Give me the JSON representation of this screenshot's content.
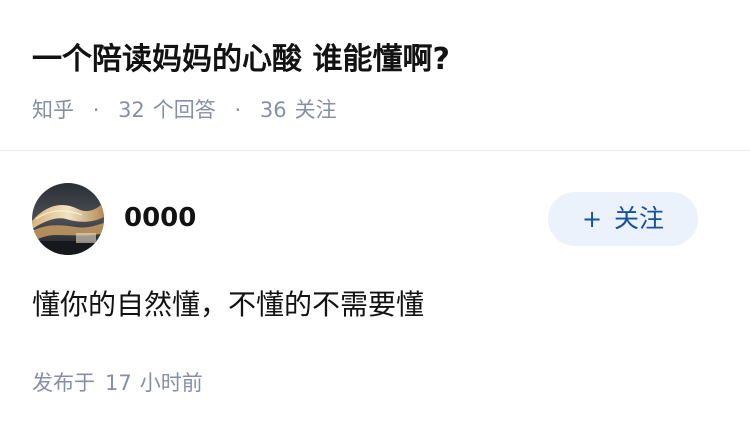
{
  "question": {
    "title": "一个陪读妈妈的心酸 谁能懂啊?",
    "source": "知乎",
    "separator": "·",
    "answers_count": "32",
    "answers_label": "个回答",
    "followers_count": "36",
    "followers_label": "关注"
  },
  "answer": {
    "author_name": "0000",
    "avatar_icon": "avatar-photo-icon",
    "follow_plus": "+",
    "follow_label": "关注",
    "content": "懂你的自然懂，不懂的不需要懂",
    "published_label": "发布于",
    "published_count": "17",
    "published_unit": "小时前"
  },
  "colors": {
    "title": "#121212",
    "meta": "#8590a6",
    "follow_bg": "#ebf2fb",
    "follow_text": "#175199",
    "divider": "#ebebeb"
  }
}
